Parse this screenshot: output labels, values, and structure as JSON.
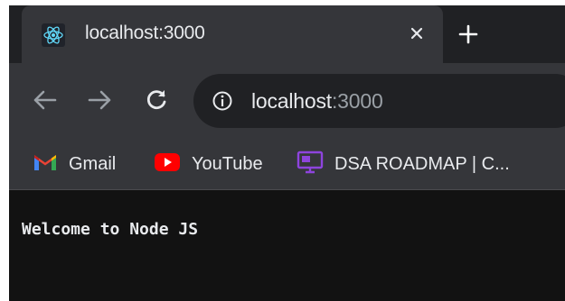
{
  "tab": {
    "title": "localhost:3000",
    "favicon_icon": "react-icon",
    "close_icon": "close-icon"
  },
  "new_tab_icon": "plus-icon",
  "toolbar": {
    "back_icon": "arrow-left-icon",
    "forward_icon": "arrow-right-icon",
    "reload_icon": "reload-icon",
    "info_icon": "info-icon",
    "url_host": "localhost",
    "url_port": ":3000"
  },
  "bookmarks": [
    {
      "label": "Gmail",
      "icon": "gmail-icon"
    },
    {
      "label": "YouTube",
      "icon": "youtube-icon"
    },
    {
      "label": "DSA ROADMAP | C...",
      "icon": "monitor-icon"
    }
  ],
  "page": {
    "text": "Welcome to Node JS"
  },
  "colors": {
    "chrome_dark": "#202124",
    "chrome_mid": "#35363a",
    "text": "#e8eaed",
    "muted": "#9aa0a6",
    "react_blue": "#61dafb",
    "youtube_red": "#ff0000",
    "bookmark_purple": "#8e44dd",
    "page_bg": "#121212"
  }
}
